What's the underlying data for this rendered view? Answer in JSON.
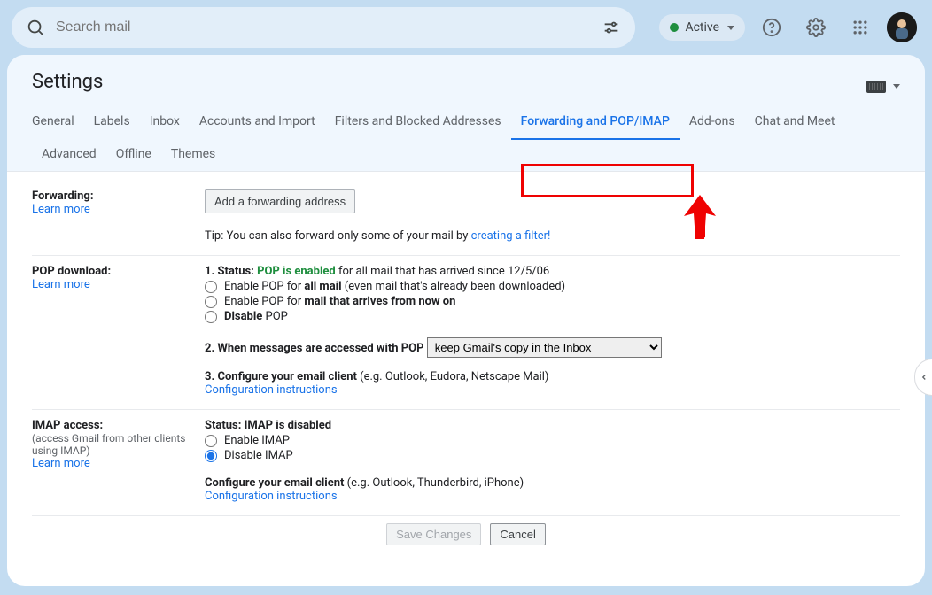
{
  "header": {
    "search_placeholder": "Search mail",
    "status_label": "Active"
  },
  "settings": {
    "title": "Settings",
    "tabs": [
      "General",
      "Labels",
      "Inbox",
      "Accounts and Import",
      "Filters and Blocked Addresses",
      "Forwarding and POP/IMAP",
      "Add-ons",
      "Chat and Meet",
      "Advanced",
      "Offline",
      "Themes"
    ],
    "active_tab": "Forwarding and POP/IMAP"
  },
  "forwarding": {
    "label": "Forwarding:",
    "learn_more": "Learn more",
    "add_button": "Add a forwarding address",
    "tip_prefix": "Tip: You can also forward only some of your mail by ",
    "tip_link": "creating a filter!"
  },
  "pop": {
    "label": "POP download:",
    "learn_more": "Learn more",
    "status_prefix": "1. Status: ",
    "status_value": "POP is enabled",
    "status_suffix": " for all mail that has arrived since 12/5/06",
    "opt_all_prefix": "Enable POP for ",
    "opt_all_bold": "all mail",
    "opt_all_suffix": " (even mail that's already been downloaded)",
    "opt_now_prefix": "Enable POP for ",
    "opt_now_bold": "mail that arrives from now on",
    "opt_disable_bold": "Disable",
    "opt_disable_suffix": " POP",
    "when_accessed_label": "2. When messages are accessed with POP",
    "when_accessed_value": "keep Gmail's copy in the Inbox",
    "configure_label": "3. Configure your email client",
    "configure_suffix": " (e.g. Outlook, Eudora, Netscape Mail)",
    "config_link": "Configuration instructions"
  },
  "imap": {
    "label": "IMAP access:",
    "sub": "(access Gmail from other clients using IMAP)",
    "learn_more": "Learn more",
    "status": "Status: IMAP is disabled",
    "enable": "Enable IMAP",
    "disable": "Disable IMAP",
    "configure_label": "Configure your email client",
    "configure_suffix": " (e.g. Outlook, Thunderbird, iPhone)",
    "config_link": "Configuration instructions"
  },
  "footer": {
    "save": "Save Changes",
    "cancel": "Cancel"
  }
}
